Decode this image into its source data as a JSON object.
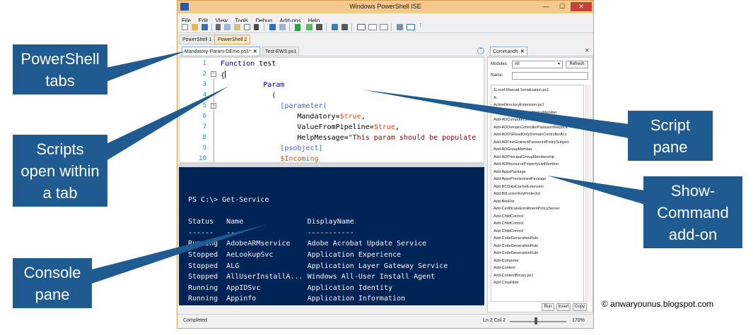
{
  "window": {
    "title": "Windows PowerShell ISE",
    "minimize": "—",
    "maximize": "☐",
    "close": "✕"
  },
  "menu": [
    "File",
    "Edit",
    "View",
    "Tools",
    "Debug",
    "Add-ons",
    "Help"
  ],
  "session_tabs": [
    "PowerShell 1",
    "PowerShell 2"
  ],
  "script_tabs": [
    {
      "label": "Mandatory-Param-DEmo.ps1*",
      "close": "✕"
    },
    {
      "label": "Test-EWS.ps1",
      "close": ""
    }
  ],
  "script_lines": [
    {
      "n": "1",
      "parts": [
        [
          "kw",
          "Function"
        ],
        [
          "txt",
          " test"
        ]
      ]
    },
    {
      "n": "2",
      "parts": [
        [
          "txt",
          "{"
        ]
      ]
    },
    {
      "n": "3",
      "parts": [
        [
          "txt",
          "          "
        ],
        [
          "kw",
          "Param"
        ]
      ]
    },
    {
      "n": "4",
      "parts": [
        [
          "txt",
          "            ("
        ]
      ]
    },
    {
      "n": "5",
      "parts": [
        [
          "txt",
          "              "
        ],
        [
          "attr",
          "[parameter("
        ]
      ]
    },
    {
      "n": "6",
      "parts": [
        [
          "txt",
          "                  Mandatory="
        ],
        [
          "var",
          "$true"
        ],
        [
          "txt",
          ","
        ]
      ]
    },
    {
      "n": "7",
      "parts": [
        [
          "txt",
          "                  ValueFromPipeline="
        ],
        [
          "var",
          "$true"
        ],
        [
          "txt",
          ","
        ]
      ]
    },
    {
      "n": "8",
      "parts": [
        [
          "txt",
          "                  HelpMessage="
        ],
        [
          "str",
          "\"This param should be populate"
        ]
      ]
    },
    {
      "n": "9",
      "parts": [
        [
          "txt",
          "              "
        ],
        [
          "attr",
          "[psobject]"
        ]
      ]
    },
    {
      "n": "10",
      "parts": [
        [
          "txt",
          "              "
        ],
        [
          "var",
          "$Incoming"
        ]
      ]
    }
  ],
  "console_lines": [
    "PS C:\\> Get-Service",
    "",
    "Status   Name               DisplayName",
    "------   ----               -----------",
    "Running  AdobeARMservice    Adobe Acrobat Update Service",
    "Stopped  AeLookupSvc        Application Experience",
    "Stopped  ALG                Application Layer Gateway Service",
    "Stopped  AllUserInstallA... Windows All-User Install Agent",
    "Running  AppIDSvc           Application Identity",
    "Running  Appinfo            Application Information"
  ],
  "commands": {
    "tab_label": "Commands",
    "tab_close": "✕",
    "pane_close": "✕",
    "modules_label": "Modules:",
    "modules_value": "All",
    "refresh_label": "Refresh",
    "name_label": "Name:",
    "items": [
      "1Level-Manual-Serialization.ps1",
      "A:",
      "ActiveDirectoryExtension.ps1",
      "Add-ADCentralAccessPolicyMember",
      "Add-ADComputerServiceAccount",
      "Add-ADDomainControllerPasswordReplica",
      "Add-ADDSReadOnlyDomainControllerAcc",
      "Add-ADFineGrainedPasswordPolicySubject",
      "Add-ADGroupMember",
      "Add-ADPrincipalGroupMembership",
      "Add-ADResourcePropertyListMember",
      "Add-AppxPackage",
      "Add-AppxProvisionedPackage",
      "Add-BCDataCacheExtension",
      "Add-BitLockerKeyProtector",
      "Add-BitsFile",
      "Add-CertificateEnrollmentPolicyServer",
      "Add-ChildControl",
      "Add-ChildControl",
      "Add-ChildControl",
      "Add-CodeGenerationRule",
      "Add-CodeGenerationRule",
      "Add-CodeGenerationRule",
      "Add-Computer",
      "Add-Content",
      "Add-ContentBinary.ps1",
      "Add-CropFilter"
    ],
    "run_label": "Run",
    "insert_label": "Insert",
    "copy_label": "Copy"
  },
  "status": {
    "left": "Completed",
    "position": "Ln 2  Col 2",
    "zoom": "170%"
  },
  "callouts": {
    "powershell_tabs": "PowerShell\ntabs",
    "scripts_tab": "Scripts\nopen within\na tab",
    "console_pane": "Console\npane",
    "script_pane": "Script\npane",
    "show_command": "Show-\nCommand\nadd-on"
  },
  "copyright": "© anwaryounus.blogspot.com",
  "colors": {
    "callout": "#1f5a91",
    "console_bg": "#012456",
    "title_bg": "#f3c98f"
  }
}
